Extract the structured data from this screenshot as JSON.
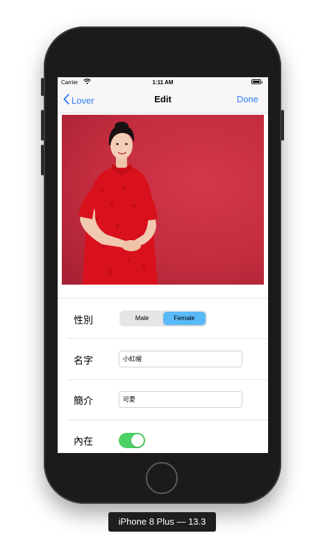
{
  "status_bar": {
    "carrier": "Carrier",
    "time": "1:11 AM"
  },
  "nav": {
    "back_label": "Lover",
    "title": "Edit",
    "done_label": "Done"
  },
  "photo": {
    "subject": "woman in red qipao",
    "background_color": "#c8303f"
  },
  "form": {
    "gender": {
      "label": "性別",
      "options": [
        "Male",
        "Female"
      ],
      "selected": "Female"
    },
    "name": {
      "label": "名字",
      "value": "小紅帽"
    },
    "intro": {
      "label": "簡介",
      "value": "可愛"
    },
    "inner": {
      "label": "內在",
      "enabled": true
    }
  },
  "device_label": "iPhone 8 Plus — 13.3",
  "colors": {
    "accent": "#2f7cf6",
    "segment_selected": "#5ab9f8",
    "switch_on": "#4cd164"
  }
}
